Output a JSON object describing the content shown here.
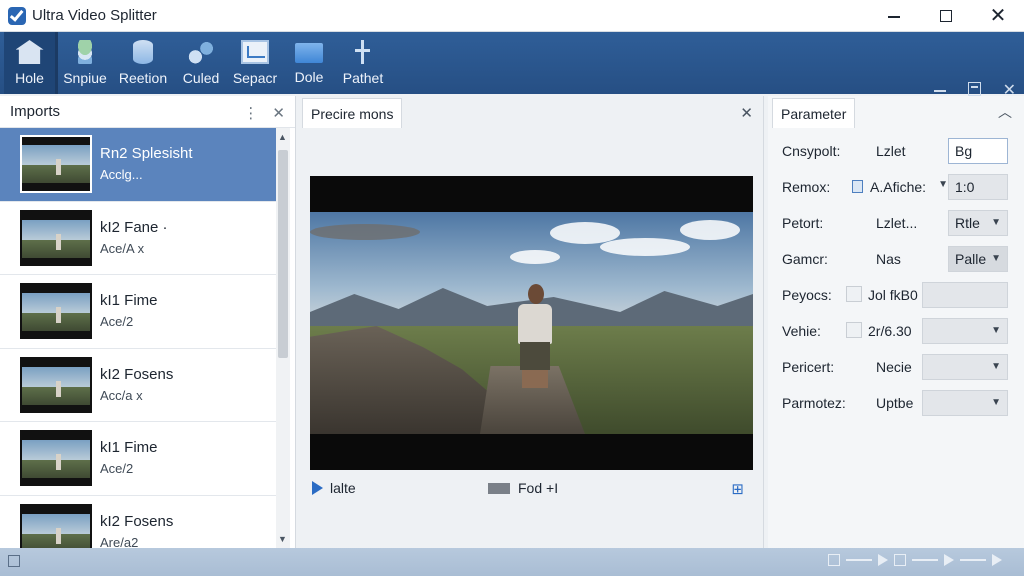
{
  "window": {
    "title": "Ultra Video Splitter",
    "minimize_icon": "minimize-icon",
    "maximize_icon": "maximize-icon",
    "close_icon": "close-icon"
  },
  "toolbar": {
    "items": [
      {
        "label": "Hole",
        "icon": "home-icon",
        "active": true
      },
      {
        "label": "Snpiue",
        "icon": "stack-icon"
      },
      {
        "label": "Reetion",
        "icon": "database-icon"
      },
      {
        "label": "Culed",
        "icon": "cut-icon"
      },
      {
        "label": "Sepacr",
        "icon": "chart-icon"
      },
      {
        "label": "Dole",
        "icon": "folder-icon"
      },
      {
        "label": "Pathet",
        "icon": "arrows-icon"
      }
    ]
  },
  "imports": {
    "title": "Imports",
    "more_glyph": "⋮",
    "close_glyph": "✕",
    "items": [
      {
        "name": "Rn2 Splesisht",
        "sub": "Acclg..."
      },
      {
        "name": "kI2 Fane ·",
        "sub": "Ace/A x"
      },
      {
        "name": "kI1 Fime",
        "sub": "Ace/2"
      },
      {
        "name": "kI2 Fosens",
        "sub": "Acc/a x"
      },
      {
        "name": "kI1 Fime",
        "sub": "Ace/2"
      },
      {
        "name": "kI2 Fosens",
        "sub": "Are/a2"
      }
    ]
  },
  "preview": {
    "tab_label": "Precire mons",
    "close_glyph": "✕",
    "play_label": "lalte",
    "stop_label": "Fod +I",
    "grid_glyph": "⊞"
  },
  "parameters": {
    "tab_label": "Parameter",
    "collapse_glyph": "︿",
    "rows": [
      {
        "label": "Cnsypolt:",
        "value": "Lzlet",
        "field": "Bg"
      },
      {
        "label": "Remox:",
        "value": "A.Afiche:",
        "field": "1:0"
      },
      {
        "label": "Petort:",
        "value": "Lzlet...",
        "field": "Rtle"
      },
      {
        "label": "Gamcr:",
        "value": "Nas",
        "field": "Palle"
      },
      {
        "label": "Peyocs:",
        "value": "Jol fkB0",
        "field": ""
      },
      {
        "label": "Vehie:",
        "value": "2r/6.30",
        "field": ""
      },
      {
        "label": "Pericert:",
        "value": "Necie",
        "field": ""
      },
      {
        "label": "Parmotez:",
        "value": "Uptbe",
        "field": ""
      }
    ]
  },
  "status": {
    "icon": "status-icon"
  }
}
